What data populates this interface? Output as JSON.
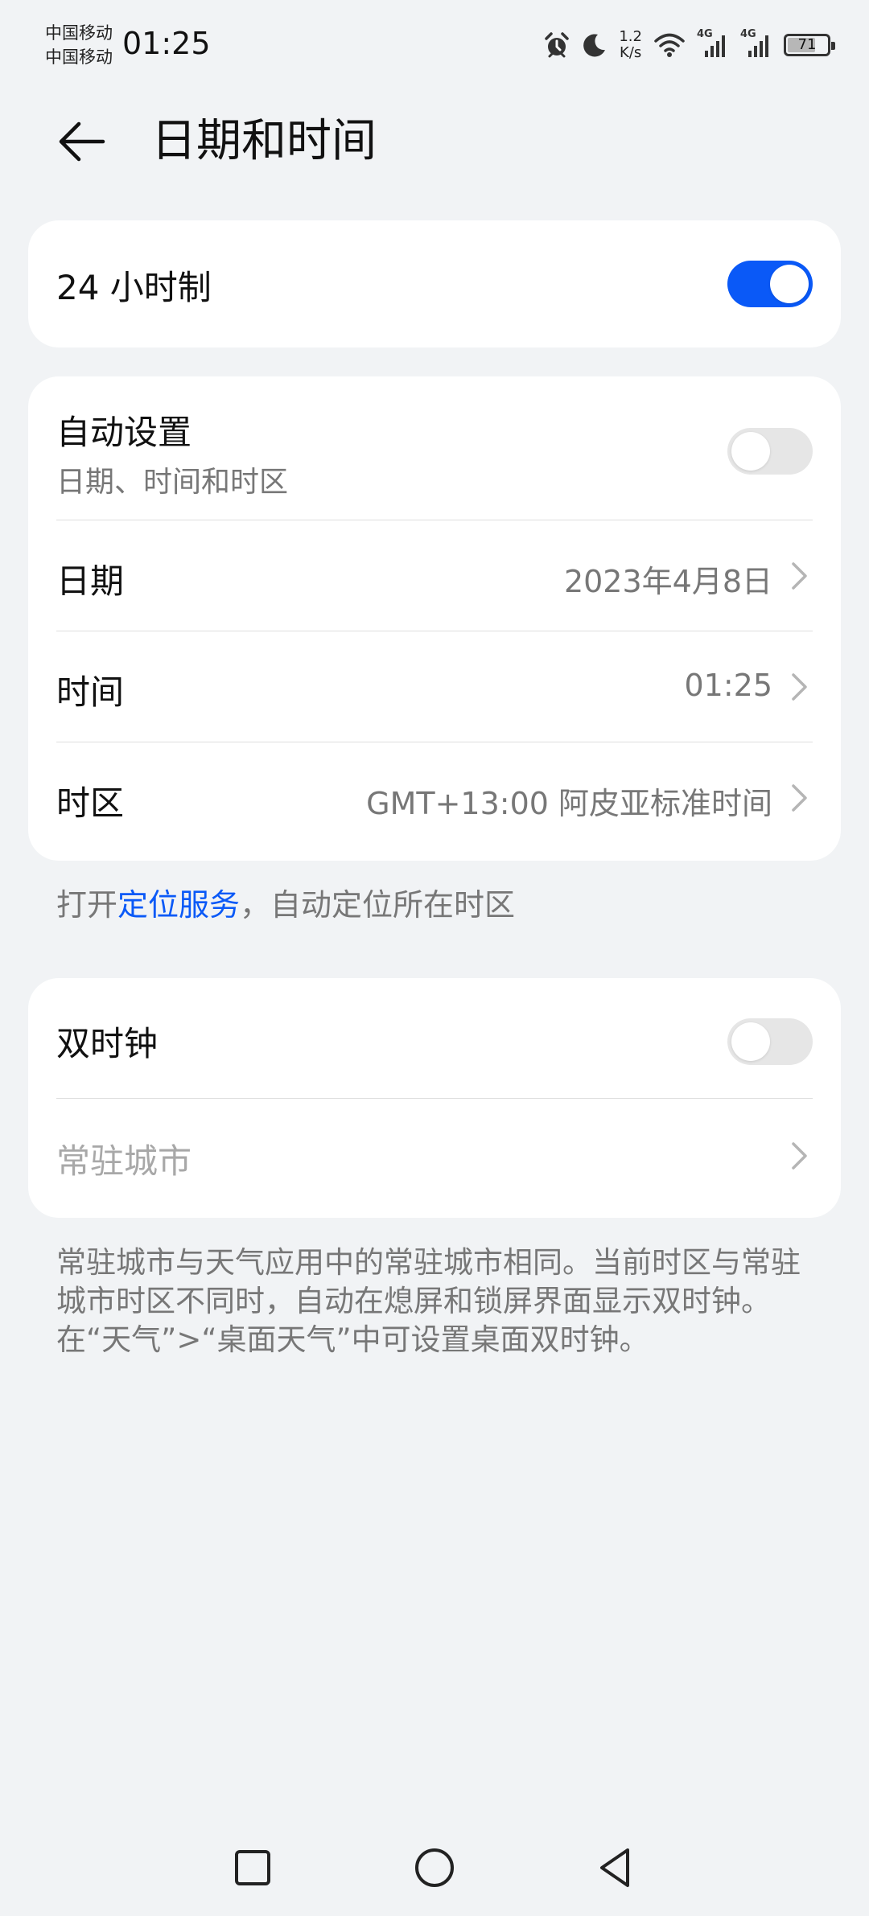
{
  "status_bar": {
    "carrier_1": "中国移动",
    "carrier_2": "中国移动",
    "time": "01:25",
    "net_speed_value": "1.2",
    "net_speed_unit": "K/s",
    "signal_1_label": "4G",
    "signal_2_label": "4G",
    "battery_level": "71"
  },
  "header": {
    "title": "日期和时间"
  },
  "format_card": {
    "hour24_label": "24 小时制",
    "hour24_on": true
  },
  "datetime_card": {
    "auto_label": "自动设置",
    "auto_sub": "日期、时间和时区",
    "auto_on": false,
    "date_label": "日期",
    "date_value": "2023年4月8日",
    "time_label": "时间",
    "time_value": "01:25",
    "timezone_label": "时区",
    "timezone_value": "GMT+13:00 阿皮亚标准时间"
  },
  "location_hint": {
    "prefix": "打开",
    "link": "定位服务",
    "suffix": "，自动定位所在时区"
  },
  "dual_clock_card": {
    "dual_label": "双时钟",
    "dual_on": false,
    "home_city_label": "常驻城市"
  },
  "footnote": "常驻城市与天气应用中的常驻城市相同。当前时区与常驻城市时区不同时，自动在熄屏和锁屏界面显示双时钟。在“天气”>“桌面天气”中可设置桌面双时钟。",
  "colors": {
    "accent": "#0a59f7",
    "background": "#f1f3f5",
    "card": "#ffffff",
    "secondary_text": "#777777"
  }
}
